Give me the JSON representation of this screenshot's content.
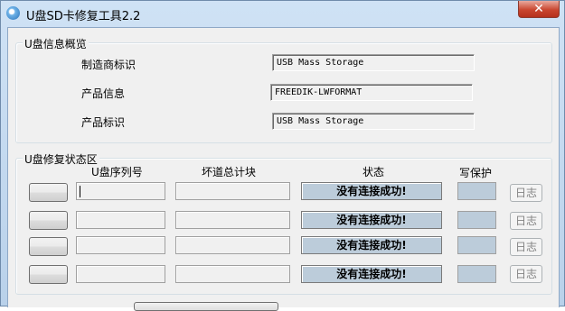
{
  "window": {
    "title": "U盘SD卡修复工具2.2",
    "close_label": "✕"
  },
  "overview": {
    "legend": "U盘信息概览",
    "rows": [
      {
        "label": "制造商标识",
        "value": "USB Mass Storage"
      },
      {
        "label": "产品信息",
        "value": "FREEDIK-LWFORMAT"
      },
      {
        "label": "产品标识",
        "value": "USB Mass Storage"
      }
    ]
  },
  "repair": {
    "legend": "U盘修复状态区",
    "headers": {
      "serial": "U盘序列号",
      "badblocks": "坏道总计块",
      "status": "状态",
      "write_protect": "写保护"
    },
    "slots": [
      {
        "status": "没有连接成功!",
        "log_label": "日志"
      },
      {
        "status": "没有连接成功!",
        "log_label": "日志"
      },
      {
        "status": "没有连接成功!",
        "log_label": "日志"
      },
      {
        "status": "没有连接成功!",
        "log_label": "日志"
      }
    ]
  },
  "colors": {
    "status_fill": "#bcccda",
    "close_red": "#c9462f",
    "frame_blue": "#b9d1ea"
  }
}
